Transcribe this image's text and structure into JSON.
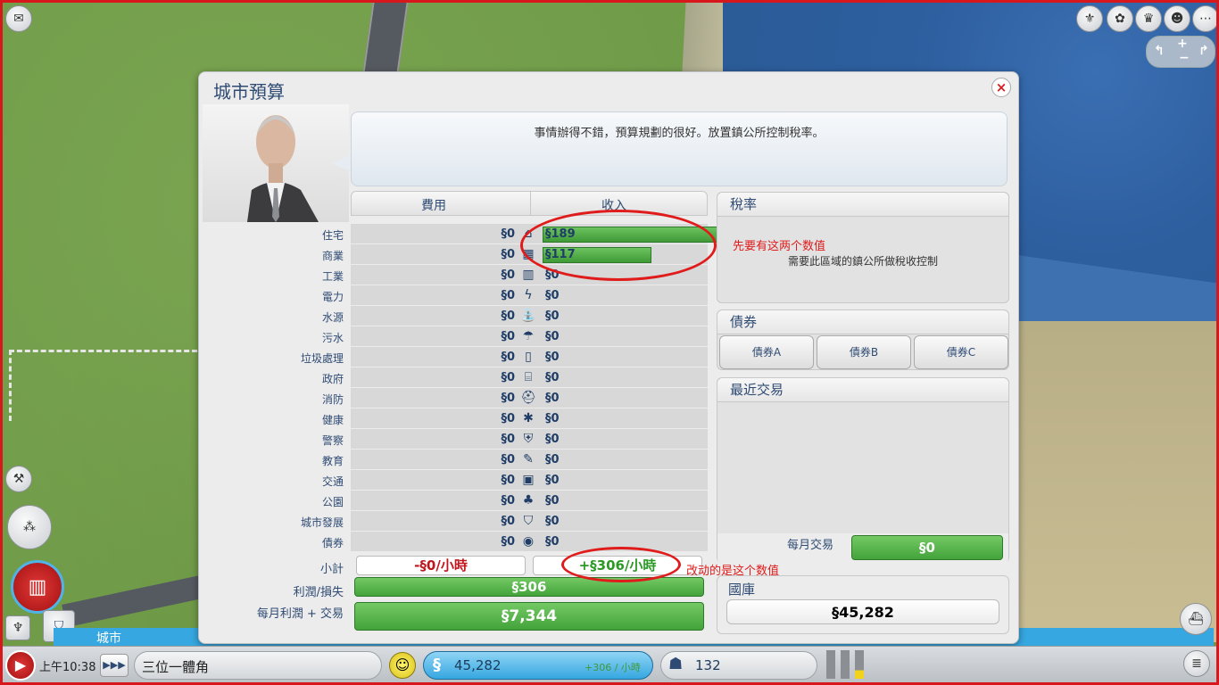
{
  "dialog": {
    "title": "城市預算",
    "close_label": "×",
    "advisor_message": "事情辦得不錯，預算規劃的很好。放置鎮公所控制稅率。"
  },
  "budget": {
    "expenses_header": "費用",
    "income_header": "收入",
    "rows": [
      {
        "label": "住宅",
        "expense": "§0",
        "icon": "house-icon",
        "glyph": "⌂",
        "income": "§189",
        "bar": 0.98
      },
      {
        "label": "商業",
        "expense": "§0",
        "icon": "store-icon",
        "glyph": "▦",
        "income": "§117",
        "bar": 0.61
      },
      {
        "label": "工業",
        "expense": "§0",
        "icon": "factory-icon",
        "glyph": "▥",
        "income": "§0",
        "bar": 0
      },
      {
        "label": "電力",
        "expense": "§0",
        "icon": "lightning-icon",
        "glyph": "ϟ",
        "income": "§0",
        "bar": 0
      },
      {
        "label": "水源",
        "expense": "§0",
        "icon": "faucet-icon",
        "glyph": "⛲",
        "income": "§0",
        "bar": 0
      },
      {
        "label": "污水",
        "expense": "§0",
        "icon": "sewage-icon",
        "glyph": "☂",
        "income": "§0",
        "bar": 0
      },
      {
        "label": "垃圾處理",
        "expense": "§0",
        "icon": "trash-icon",
        "glyph": "▯",
        "income": "§0",
        "bar": 0
      },
      {
        "label": "政府",
        "expense": "§0",
        "icon": "government-icon",
        "glyph": "⌸",
        "income": "§0",
        "bar": 0
      },
      {
        "label": "消防",
        "expense": "§0",
        "icon": "fire-helmet-icon",
        "glyph": "⛑",
        "income": "§0",
        "bar": 0
      },
      {
        "label": "健康",
        "expense": "§0",
        "icon": "medical-icon",
        "glyph": "✱",
        "income": "§0",
        "bar": 0
      },
      {
        "label": "警察",
        "expense": "§0",
        "icon": "police-badge-icon",
        "glyph": "⛨",
        "income": "§0",
        "bar": 0
      },
      {
        "label": "教育",
        "expense": "§0",
        "icon": "education-icon",
        "glyph": "✎",
        "income": "§0",
        "bar": 0
      },
      {
        "label": "交通",
        "expense": "§0",
        "icon": "bus-icon",
        "glyph": "▣",
        "income": "§0",
        "bar": 0
      },
      {
        "label": "公園",
        "expense": "§0",
        "icon": "tree-icon",
        "glyph": "♣",
        "income": "§0",
        "bar": 0
      },
      {
        "label": "城市發展",
        "expense": "§0",
        "icon": "shield-icon",
        "glyph": "⛉",
        "income": "§0",
        "bar": 0
      },
      {
        "label": "債券",
        "expense": "§0",
        "icon": "moneybag-icon",
        "glyph": "◉",
        "income": "§0",
        "bar": 0
      }
    ],
    "subtotal_label": "小計",
    "subtotal_expense": "-§0/小時",
    "subtotal_income": "+§306/小時",
    "profit_label": "利潤/損失",
    "profit_value": "§306",
    "monthly_label": "每月利潤 + 交易",
    "monthly_value": "§7,344"
  },
  "tax": {
    "header": "稅率",
    "note": "需要此區域的鎮公所做稅收控制"
  },
  "bonds": {
    "header": "債券",
    "buttons": [
      "債券A",
      "債券B",
      "債券C"
    ]
  },
  "transactions": {
    "header": "最近交易",
    "monthly_label": "每月交易",
    "monthly_value": "§0"
  },
  "treasury": {
    "header": "國庫",
    "value": "§45,282"
  },
  "annotations": {
    "note1": "先要有这两个数值",
    "note2": "改动的是这个数值"
  },
  "statusbar": {
    "time": "上午10:38",
    "speed": "▶▶▶",
    "city_name": "三位一體角",
    "funds": "45,282",
    "funds_rate": "+306 / 小時",
    "population": "132",
    "city_tab": "城市"
  },
  "colors": {
    "accent_blue": "#2f4b73",
    "income_green": "#3f9a37",
    "expense_red": "#c0161d",
    "annotation_red": "#e01b1b"
  }
}
